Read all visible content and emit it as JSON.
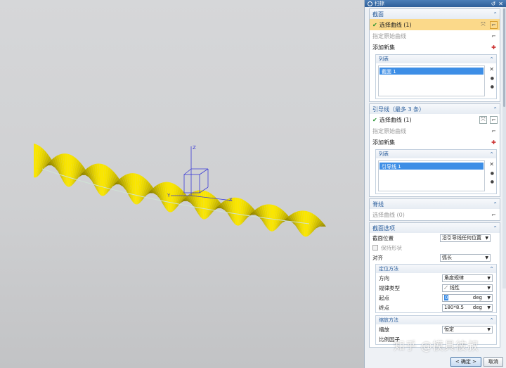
{
  "dialog": {
    "title": "扫掠",
    "section_group": {
      "title": "截面",
      "select_curve": "选择曲线 (1)",
      "specify_origin": "指定原始曲线",
      "add_new_set": "添加新集",
      "list_title": "列表",
      "list_items": [
        "截面 1"
      ]
    },
    "guide_group": {
      "title": "引导线（最多 3 条）",
      "select_curve": "选择曲线 (1)",
      "specify_origin": "指定原始曲线",
      "add_new_set": "添加新集",
      "list_title": "列表",
      "list_items": [
        "引导线 1"
      ]
    },
    "spine_group": {
      "title": "脊线",
      "select_curve": "选择曲线 (0)"
    },
    "section_options": {
      "title": "截面选项",
      "position_label": "截面位置",
      "position_value": "沿引导线任何位置",
      "keep_shape": "保持形状",
      "align_label": "对齐",
      "align_value": "弧长",
      "orientation": {
        "title": "定位方法",
        "direction_label": "方向",
        "direction_value": "角度规律",
        "law_type_label": "规律类型",
        "law_type_value": "线性",
        "start_label": "起点",
        "start_value": "0",
        "start_unit": "deg",
        "end_label": "终点",
        "end_value": "180*8.5",
        "end_unit": "deg"
      },
      "scaling": {
        "title": "缩放方法",
        "scale_label": "缩放",
        "scale_value": "恒定",
        "ratio_label": "比例因子"
      }
    },
    "ok_label": "< 确定 >",
    "cancel_label": "取消"
  },
  "viewport": {
    "axes": {
      "x": "X",
      "y": "Y",
      "z": "Z"
    }
  },
  "watermark": "知乎 @模具彼叔",
  "colors": {
    "accent": "#2a5d9b",
    "highlight": "#fbd98a",
    "selection": "#3d8ee6",
    "surface": "#f2e600"
  }
}
